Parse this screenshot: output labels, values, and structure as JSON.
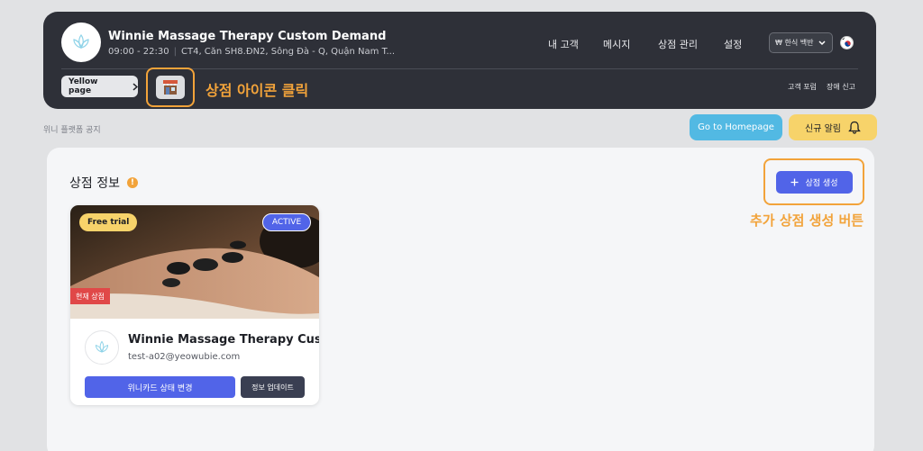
{
  "header": {
    "shop_title": "Winnie Massage Therapy Custom Demand",
    "hours": "09:00 - 22:30",
    "address": "CT4, Căn SH8.ĐN2, Sông Đà - Q, Quận Nam T...",
    "nav": [
      "내 고객",
      "메시지",
      "상점 관리",
      "설정"
    ],
    "language_select": "₩ 한식 백반",
    "yellow_page_label": "Yellow page",
    "store_icon_annotation": "상점 아이콘 클릭",
    "right_links": [
      "고객 포럼",
      "장애 신고"
    ]
  },
  "notice_text": "위니 플랫폼 공지",
  "home_button": "Go to Homepage",
  "alert_button": "신규 알림",
  "main": {
    "section_title": "상점 정보",
    "create_button": "상점 생성",
    "create_annotation": "추가 상점 생성 버튼",
    "card": {
      "badge_trial": "Free trial",
      "badge_active": "ACTIVE",
      "badge_current": "현재 상점",
      "name": "Winnie Massage Therapy Custo",
      "email": "test-a02@yeowubie.com",
      "status_button": "위니카드 상태 변경",
      "update_button": "정보 업데이트"
    }
  },
  "colors": {
    "header_bg": "#2e3038",
    "primary": "#5164e8",
    "annotation": "#f2a33a",
    "alert_yellow": "#f7d36a",
    "home_blue": "#52b9e3"
  }
}
